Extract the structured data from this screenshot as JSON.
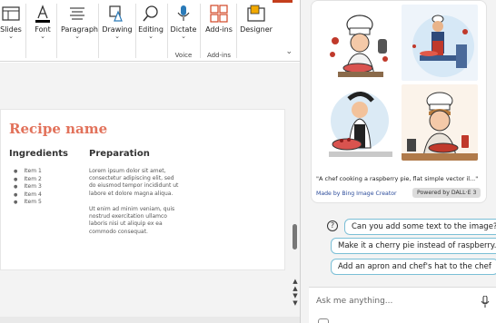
{
  "ribbon": {
    "buttons": [
      {
        "label": "Slides",
        "icon": "slides-icon",
        "has_chevron": true
      },
      {
        "label": "Font",
        "icon": "font-color-icon",
        "has_chevron": true
      },
      {
        "label": "Paragraph",
        "icon": "paragraph-icon",
        "has_chevron": true
      },
      {
        "label": "Drawing",
        "icon": "drawing-icon",
        "has_chevron": true
      },
      {
        "label": "Editing",
        "icon": "search-icon",
        "has_chevron": true
      },
      {
        "label": "Dictate",
        "icon": "microphone-icon",
        "has_chevron": true
      },
      {
        "label": "Add-ins",
        "icon": "add-ins-icon",
        "has_chevron": false
      },
      {
        "label": "Designer",
        "icon": "designer-icon",
        "has_chevron": false
      }
    ],
    "groups": {
      "voice": "Voice",
      "addins": "Add-ins"
    },
    "accent_color": "#c43e1c",
    "font_color_bar": "#000000"
  },
  "slide": {
    "title": "Recipe name",
    "title_color": "#e2725b",
    "ingredients_heading": "Ingredients",
    "preparation_heading": "Preparation",
    "ingredients": [
      "Item 1",
      "Item 2",
      "Item 3",
      "Item 4",
      "Item 5"
    ],
    "prep_paragraph_1": "Lorem ipsum dolor sit amet, consectetur adipiscing elit, sed do eiusmod tempor incididunt ut labore et dolore magna aliqua.",
    "prep_paragraph_2": "Ut enim ad minim veniam, quis nostrud exercitation ullamco laboris nisi ut aliquip ex ea commodo consequat."
  },
  "copilot": {
    "image_caption": "\"A chef cooking a raspberry pie, flat simple vector il...\"",
    "credit": "Made by Bing Image Creator",
    "powered_by": "Powered by DALL·E 3",
    "suggestions": [
      "Can you add some text to the image?",
      "Make it a cherry pie instead of raspberry.",
      "Add an apron and chef's hat to the chef"
    ],
    "ask_placeholder": "Ask me anything...",
    "chip_border_color": "#7bbfd6"
  }
}
